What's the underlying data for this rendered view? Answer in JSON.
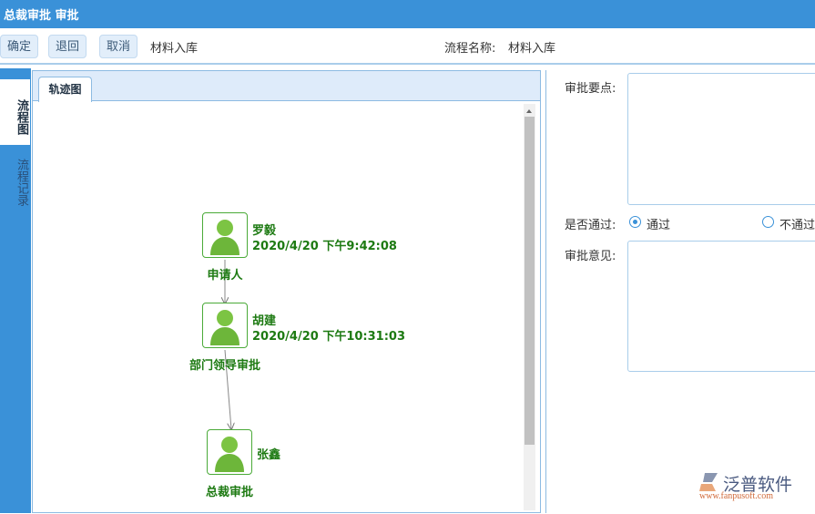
{
  "title": "总裁审批 审批",
  "toolbar": {
    "confirm": "确定",
    "back": "退回",
    "cancel": "取消",
    "doc": "材料入库",
    "flow_label": "流程名称:",
    "flow_name": "材料入库"
  },
  "sidebar": {
    "tabs": [
      "流程图",
      "流程记录"
    ]
  },
  "left": {
    "tab": "轨迹图",
    "nodes": [
      {
        "name": "罗毅",
        "time": "2020/4/20 下午9:42:08",
        "role": "申请人"
      },
      {
        "name": "胡建",
        "time": "2020/4/20 下午10:31:03",
        "role": "部门领导审批"
      },
      {
        "name": "张鑫",
        "time": "",
        "role": "总裁审批"
      }
    ]
  },
  "right": {
    "points_label": "审批要点:",
    "pass_label": "是否通过:",
    "pass": "通过",
    "fail": "不通过",
    "opinion_label": "审批意见:",
    "selected": "通过"
  },
  "logo": {
    "name": "泛普软件",
    "url": "www.fanpusoft.com"
  }
}
